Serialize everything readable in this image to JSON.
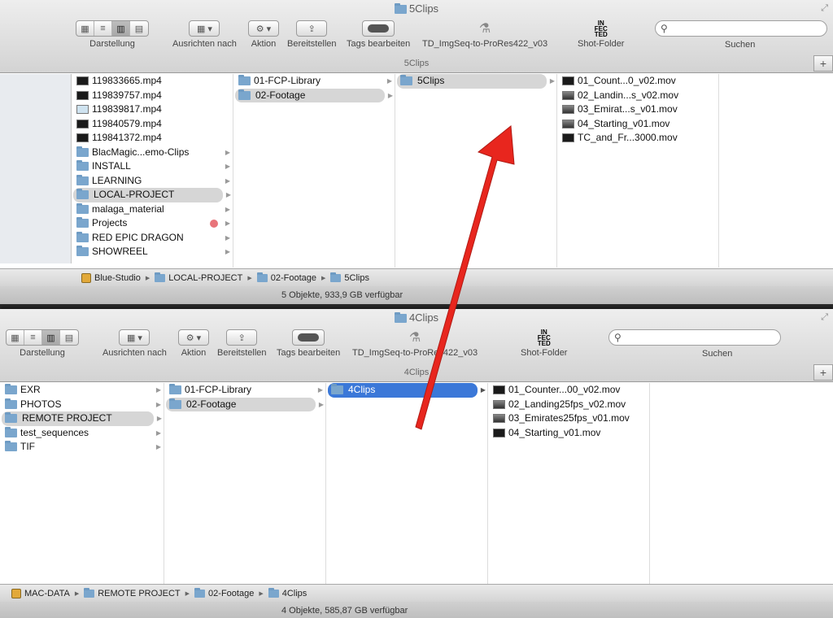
{
  "windows": [
    {
      "title": "5Clips",
      "toolbar": {
        "view_label": "Darstellung",
        "arrange_label": "Ausrichten nach",
        "action_label": "Aktion",
        "share_label": "Bereitstellen",
        "tags_label": "Tags bearbeiten",
        "script_label": "TD_ImgSeq-to-ProRes422_v03",
        "shot_label": "Shot-Folder",
        "search_label": "Suchen"
      },
      "path_title": "5Clips",
      "columns": [
        {
          "items": [
            {
              "label": "119833665.mp4",
              "icon": "video-dark"
            },
            {
              "label": "119839757.mp4",
              "icon": "video-dark"
            },
            {
              "label": "119839817.mp4",
              "icon": "video-light"
            },
            {
              "label": "119840579.mp4",
              "icon": "video-dark"
            },
            {
              "label": "119841372.mp4",
              "icon": "video-dark"
            },
            {
              "label": "BlacMagic...emo-Clips",
              "icon": "folder"
            },
            {
              "label": "INSTALL",
              "icon": "folder"
            },
            {
              "label": "LEARNING",
              "icon": "folder"
            },
            {
              "label": "LOCAL-PROJECT",
              "icon": "folder"
            },
            {
              "label": "malaga_material",
              "icon": "folder"
            },
            {
              "label": "Projects",
              "icon": "folder"
            },
            {
              "label": "RED EPIC DRAGON",
              "icon": "folder"
            },
            {
              "label": "SHOWREEL",
              "icon": "folder"
            }
          ]
        },
        {
          "items": [
            {
              "label": "01-FCP-Library",
              "icon": "folder"
            },
            {
              "label": "02-Footage",
              "icon": "folder"
            }
          ]
        },
        {
          "items": [
            {
              "label": "5Clips",
              "icon": "folder"
            }
          ]
        },
        {
          "items": [
            {
              "label": "01_Count...0_v02.mov",
              "icon": "video-dark"
            },
            {
              "label": "02_Landin...s_v02.mov",
              "icon": "video-gray"
            },
            {
              "label": "03_Emirat...s_v01.mov",
              "icon": "video-gray"
            },
            {
              "label": "04_Starting_v01.mov",
              "icon": "video-gray"
            },
            {
              "label": "TC_and_Fr...3000.mov",
              "icon": "video-dark"
            }
          ]
        }
      ],
      "pathbar": [
        "Blue-Studio",
        "LOCAL-PROJECT",
        "02-Footage",
        "5Clips"
      ],
      "status": "5 Objekte, 933,9 GB verfügbar"
    },
    {
      "title": "4Clips",
      "toolbar": {
        "view_label": "Darstellung",
        "arrange_label": "Ausrichten nach",
        "action_label": "Aktion",
        "share_label": "Bereitstellen",
        "tags_label": "Tags bearbeiten",
        "script_label": "TD_ImgSeq-to-ProRes422_v03",
        "shot_label": "Shot-Folder",
        "search_label": "Suchen"
      },
      "path_title": "4Clips",
      "columns": [
        {
          "items": [
            {
              "label": "EXR",
              "icon": "folder"
            },
            {
              "label": "PHOTOS",
              "icon": "folder"
            },
            {
              "label": "REMOTE PROJECT",
              "icon": "folder"
            },
            {
              "label": "test_sequences",
              "icon": "folder"
            },
            {
              "label": "TIF",
              "icon": "folder"
            }
          ]
        },
        {
          "items": [
            {
              "label": "01-FCP-Library",
              "icon": "folder"
            },
            {
              "label": "02-Footage",
              "icon": "folder"
            }
          ]
        },
        {
          "items": [
            {
              "label": "4Clips",
              "icon": "folder"
            }
          ]
        },
        {
          "items": [
            {
              "label": "01_Counter...00_v02.mov",
              "icon": "video-dark"
            },
            {
              "label": "02_Landing25fps_v02.mov",
              "icon": "video-gray"
            },
            {
              "label": "03_Emirates25fps_v01.mov",
              "icon": "video-gray"
            },
            {
              "label": "04_Starting_v01.mov",
              "icon": "video-dark"
            }
          ]
        }
      ],
      "pathbar": [
        "MAC-DATA",
        "REMOTE PROJECT",
        "02-Footage",
        "4Clips"
      ],
      "status": "4 Objekte, 585,87 GB verfügbar"
    }
  ],
  "annotation": {
    "color": "#e8261e",
    "icon": "red-arrow-icon"
  }
}
